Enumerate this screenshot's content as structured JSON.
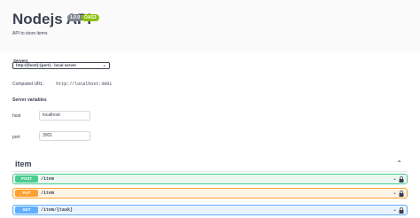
{
  "info": {
    "title": "Nodejs API",
    "version": "1.0.0",
    "oas": "OAS3",
    "description": "API to store items"
  },
  "servers": {
    "label": "Servers",
    "selected": "http://{host}:{port} - local server"
  },
  "computed": {
    "label": "Computed URL:",
    "url": "http://localhost:3001"
  },
  "server_variables": {
    "title": "Server variables",
    "vars": [
      {
        "name": "host",
        "value": "localhost"
      },
      {
        "name": "port",
        "value": "3001"
      }
    ]
  },
  "tag": {
    "name": "item"
  },
  "operations": [
    {
      "method": "POST",
      "path": "/item",
      "color": "#49cc90"
    },
    {
      "method": "PUT",
      "path": "/item",
      "color": "#fca130"
    },
    {
      "method": "GET",
      "path": "/item/{task}",
      "color": "#61affe"
    }
  ]
}
